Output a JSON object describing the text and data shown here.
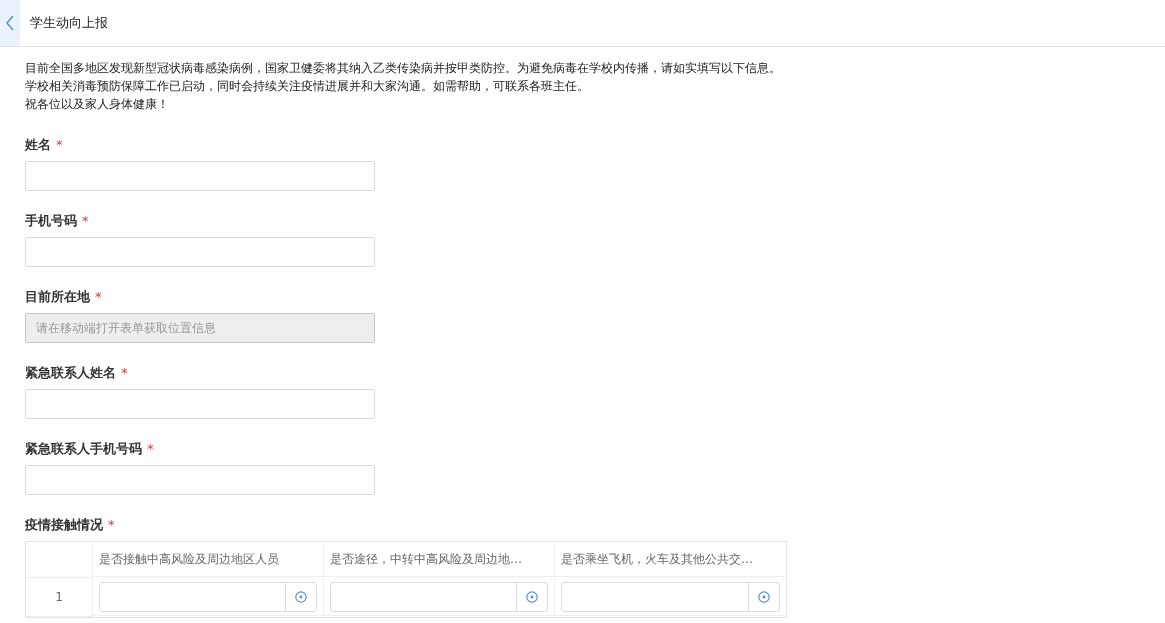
{
  "header": {
    "title": "学生动向上报"
  },
  "intro": [
    "目前全国多地区发现新型冠状病毒感染病例，国家卫健委将其纳入乙类传染病并按甲类防控。为避免病毒在学校内传播，请如实填写以下信息。",
    "学校相关消毒预防保障工作已启动，同时会持续关注疫情进展并和大家沟通。如需帮助，可联系各班主任。",
    "祝各位以及家人身体健康！"
  ],
  "fields": [
    {
      "label": "姓名",
      "required_mark": "*",
      "disabled": false
    },
    {
      "label": "手机号码",
      "required_mark": "*",
      "disabled": false
    },
    {
      "label": "目前所在地",
      "required_mark": "*",
      "disabled": true,
      "placeholder": "请在移动端打开表单获取位置信息"
    },
    {
      "label": "紧急联系人姓名",
      "required_mark": "*",
      "disabled": false
    },
    {
      "label": "紧急联系人手机号码",
      "required_mark": "*",
      "disabled": false
    }
  ],
  "table_section": {
    "label": "疫情接触情况",
    "required_mark": "*",
    "columns": [
      "是否接触中高风险及周边地区人员",
      "是否途径，中转中高风险及周边地…",
      "是否乘坐飞机，火车及其他公共交…"
    ],
    "rows": [
      {
        "index": "1"
      }
    ]
  }
}
